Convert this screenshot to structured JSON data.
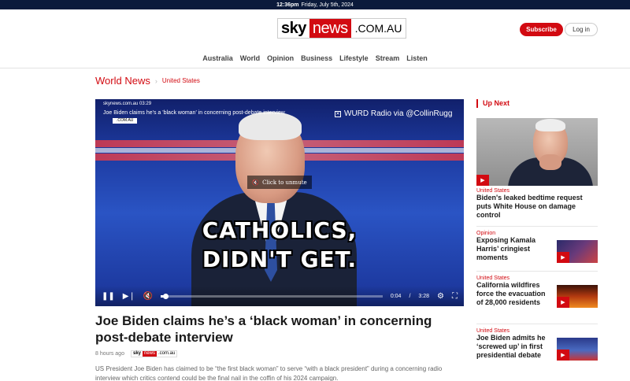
{
  "topbar": {
    "time": "12:36pm",
    "date": "Friday, July 5th, 2024"
  },
  "header": {
    "logo": {
      "sky": "sky",
      "news": "news",
      "domain": ".COM.AU"
    },
    "subscribe_label": "Subscribe",
    "login_label": "Log in"
  },
  "nav": {
    "items": [
      {
        "label": "Australia"
      },
      {
        "label": "World"
      },
      {
        "label": "Opinion"
      },
      {
        "label": "Business"
      },
      {
        "label": "Lifestyle"
      },
      {
        "label": "Stream"
      },
      {
        "label": "Listen"
      }
    ]
  },
  "breadcrumb": {
    "section": "World News",
    "subsection": "United States"
  },
  "video": {
    "site_label": "skynews.com.au 03:29",
    "mini_logo": {
      "sky": "sky",
      "news": "news",
      "domain": ".COM.AU"
    },
    "title": "Joe Biden claims he's a 'black woman' in concerning post-debate interview",
    "credit": "WURD Radio via @CollinRugg",
    "unmute_label": "Click to unmute",
    "caption_line1": "CATHOLICS,",
    "caption_line2": "DIDN'T GET.",
    "current_time": "0:04",
    "time_sep": "/",
    "duration": "3:28",
    "progress_fraction": 0.02
  },
  "article": {
    "headline": "Joe Biden claims he’s a ‘black woman’ in concerning post-debate interview",
    "age": "8 hours ago",
    "meta_logo": {
      "sky": "sky",
      "news": "news",
      "domain": ".com.au"
    },
    "body": "US President Joe Biden has claimed to be “the first black woman” to serve “with a black president” during a concerning radio interview which critics contend could be the final nail in the coffin of his 2024 campaign."
  },
  "upnext": {
    "heading": "Up Next",
    "items": [
      {
        "category": "United States",
        "title": "Biden's leaked bedtime request puts White House on damage control"
      },
      {
        "category": "Opinion",
        "title": "Exposing Kamala Harris’ cringiest moments"
      },
      {
        "category": "United States",
        "title": "California wildfires force the evacuation of 28,000 residents"
      },
      {
        "category": "United States",
        "title": "Joe Biden admits he ‘screwed up’ in first presidential debate"
      }
    ]
  },
  "colors": {
    "brand_red": "#d20a11",
    "topbar_navy": "#0b1a3b"
  },
  "icons": [
    "play-icon",
    "pause-icon",
    "next-icon",
    "mute-icon",
    "settings-icon",
    "fullscreen-icon",
    "x-logo-icon"
  ]
}
